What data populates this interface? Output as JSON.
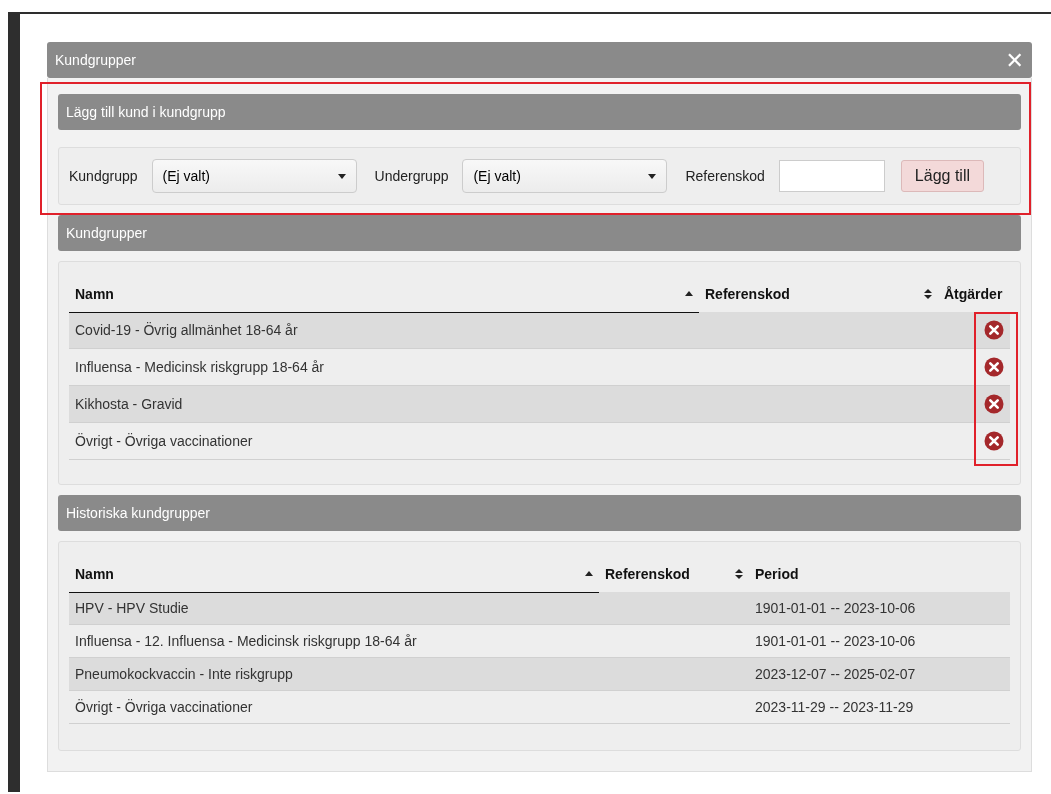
{
  "dialog": {
    "title": "Kundgrupper",
    "close": "✕"
  },
  "add_section": {
    "title": "Lägg till kund i kundgrupp",
    "highlighted": true,
    "fields": [
      {
        "kind": "select",
        "label": "Kundgrupp",
        "value": "(Ej valt)"
      },
      {
        "kind": "select",
        "label": "Undergrupp",
        "value": "(Ej valt)"
      },
      {
        "kind": "text",
        "label": "Referenskod"
      }
    ],
    "button": "Lägg till"
  },
  "groups": {
    "title": "Kundgrupper",
    "actions_highlighted": true,
    "columns": [
      {
        "label": "Namn",
        "sortable": true,
        "sorted": true
      },
      {
        "label": "Referenskod",
        "sortable": true,
        "sorted": false
      },
      {
        "label": "Åtgärder",
        "sortable": false,
        "sorted": false
      }
    ],
    "rows": [
      {
        "name": "Covid-19 - Övrig allmänhet 18-64 år"
      },
      {
        "name": "Influensa - Medicinsk riskgrupp 18-64 år"
      },
      {
        "name": "Kikhosta - Gravid"
      },
      {
        "name": "Övrigt - Övriga vaccinationer"
      }
    ]
  },
  "history": {
    "title": "Historiska kundgrupper",
    "columns": [
      {
        "label": "Namn",
        "sortable": true,
        "sorted": true
      },
      {
        "label": "Referenskod",
        "sortable": true,
        "sorted": false
      },
      {
        "label": "Period",
        "sortable": false,
        "sorted": false
      }
    ],
    "rows": [
      {
        "name": "HPV - HPV Studie",
        "period": "1901-01-01 -- 2023-10-06"
      },
      {
        "name": "Influensa - 12. Influensa - Medicinsk riskgrupp 18-64 år",
        "period": "1901-01-01 -- 2023-10-06"
      },
      {
        "name": "Pneumokockvaccin - Inte riskgrupp",
        "period": "2023-12-07 -- 2025-02-07"
      },
      {
        "name": "Övrigt - Övriga vaccinationer",
        "period": "2023-11-29 -- 2023-11-29"
      }
    ]
  }
}
